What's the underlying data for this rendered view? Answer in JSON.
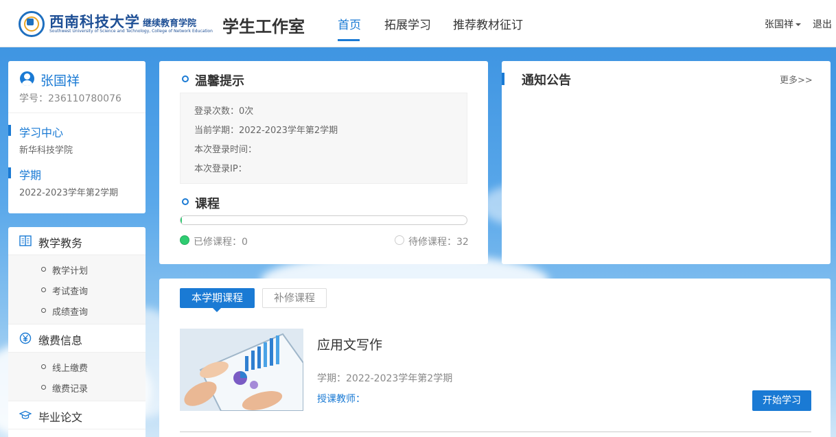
{
  "header": {
    "logo_title": "西南科技大学",
    "logo_sub": "继续教育学院",
    "logo_en": "Southwest University of Science and Technology, College of Network Education",
    "studio_title": "学生工作室",
    "nav": [
      {
        "label": "首页",
        "active": true
      },
      {
        "label": "拓展学习",
        "active": false
      },
      {
        "label": "推荐教材征订",
        "active": false
      }
    ],
    "user_name": "张国祥",
    "logout_label": "退出"
  },
  "profile": {
    "name": "张国祥",
    "student_id": "学号：236110780076",
    "study_center_label": "学习中心",
    "study_center_value": "新华科技学院",
    "term_label": "学期",
    "term_value": "2022-2023学年第2学期"
  },
  "menu": {
    "teaching": {
      "label": "教学教务",
      "icon": "book-icon",
      "items": [
        "教学计划",
        "考试查询",
        "成绩查询"
      ]
    },
    "fees": {
      "label": "缴费信息",
      "icon": "yen-icon",
      "items": [
        "线上缴费",
        "缴费记录"
      ]
    },
    "thesis": {
      "label": "毕业论文",
      "icon": "graduation-cap-icon"
    }
  },
  "tips": {
    "title": "温馨提示",
    "login_count": "登录次数：0次",
    "current_term": "当前学期：2022-2023学年第2学期",
    "login_time": "本次登录时间：",
    "login_ip": "本次登录IP："
  },
  "courses_summary": {
    "title": "课程",
    "completed_label": "已修课程：0",
    "pending_label": "待修课程：32",
    "completed": 0,
    "pending": 32,
    "completed_color": "#2ecc71"
  },
  "notice": {
    "title": "通知公告",
    "more_label": "更多>>"
  },
  "course_panel": {
    "tab_current": "本学期课程",
    "tab_makeup": "补修课程",
    "course": {
      "name": "应用文写作",
      "term": "学期：2022-2023学年第2学期",
      "teacher": "授课教师：",
      "start_label": "开始学习"
    }
  },
  "colors": {
    "accent": "#1a7ad4",
    "brand": "#1e4f95"
  }
}
